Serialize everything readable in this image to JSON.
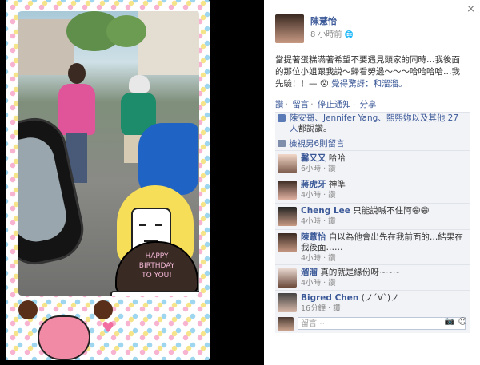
{
  "post": {
    "author": "陳薏怡",
    "time": "8 小時前",
    "privacy_icon": "globe-icon",
    "text": "當提著蛋糕滿著希望不要遇見頭家的同時…我後面的那位小姐跟我說～歸看勞邊～～～哈哈哈哈…我先驗！！—",
    "feeling": "覺得驚訝：和溜溜。"
  },
  "actions": {
    "like": "讚",
    "comment": "留言",
    "stop_notify": "停止通知",
    "share": "分享"
  },
  "likes": {
    "text_pre": "陳安哥、Jennifer Yang、熙熙妳以及其他 27 人",
    "text_post": "都說讚。"
  },
  "view_previous": "檢視另6則留言",
  "comments": [
    {
      "name": "馨又又",
      "text": "哈哈",
      "time": "6小時",
      "like": "讚"
    },
    {
      "name": "蔣虎牙",
      "text": "神準",
      "time": "4小時",
      "like": "讚"
    },
    {
      "name": "Cheng Lee",
      "text": "只能說喊不住阿😁😁",
      "time": "4小時",
      "like": "讚"
    },
    {
      "name": "陳薏怡",
      "text": "自以為他會出先在我前面的…結果在我後面……",
      "time": "4小時",
      "like": "讚"
    },
    {
      "name": "溜溜",
      "text": "真的就是緣份呀~~~",
      "time": "4小時",
      "like": "讚"
    },
    {
      "name": "Bigred Chen",
      "text": "(ノ´∀`)ノ",
      "time": "16分鐘",
      "like": "讚"
    }
  ],
  "input_placeholder": "留言⋯",
  "photo": {
    "cake_line1": "HAPPY",
    "cake_line2": "BIRTHDAY",
    "cake_line3": "TO YOU!"
  },
  "close_label": "×"
}
